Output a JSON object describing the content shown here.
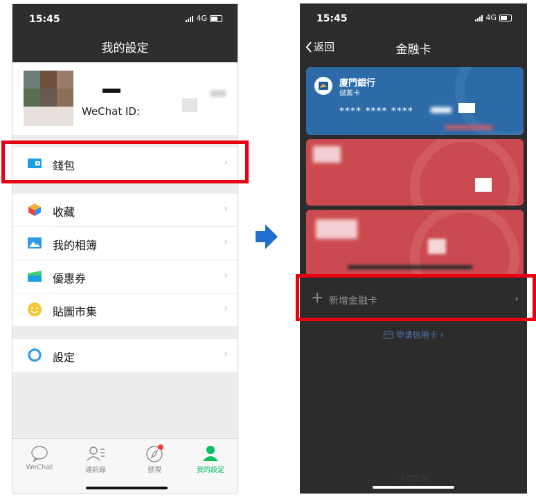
{
  "left_phone": {
    "status": {
      "time": "15:45",
      "network": "4G"
    },
    "nav_title": "我的設定",
    "profile": {
      "wechat_id_label": "WeChat ID:"
    },
    "menu": [
      {
        "label": "錢包",
        "icon": "wallet-icon"
      },
      {
        "label": "收藏",
        "icon": "favorites-icon"
      },
      {
        "label": "我的相簿",
        "icon": "album-icon"
      },
      {
        "label": "優惠券",
        "icon": "coupon-icon"
      },
      {
        "label": "貼圖市集",
        "icon": "sticker-icon"
      },
      {
        "label": "設定",
        "icon": "settings-icon"
      }
    ],
    "chevron": "›",
    "tabs": [
      {
        "label": "WeChat",
        "icon": "chat-bubble-icon"
      },
      {
        "label": "通訊錄",
        "icon": "contacts-icon"
      },
      {
        "label": "發現",
        "icon": "compass-icon"
      },
      {
        "label": "我的設定",
        "icon": "person-icon",
        "active": true
      }
    ]
  },
  "right_phone": {
    "status": {
      "time": "15:45",
      "network": "4G"
    },
    "back_label": "返回",
    "nav_title": "金融卡",
    "cards": [
      {
        "bank": "廈門銀行",
        "type": "儲蓄卡",
        "number": "**** **** ****"
      }
    ],
    "add_card": {
      "plus": "+",
      "label": "新增金融卡",
      "chevron": "›"
    },
    "apply_credit": "申请信用卡 ›",
    "faq": "常見問題"
  },
  "colors": {
    "highlight": "#e60012",
    "wechat_green": "#07c160",
    "card_blue": "#2c6aa8",
    "card_red": "#cb4a4f",
    "arrow_blue": "#1f6fd0"
  }
}
